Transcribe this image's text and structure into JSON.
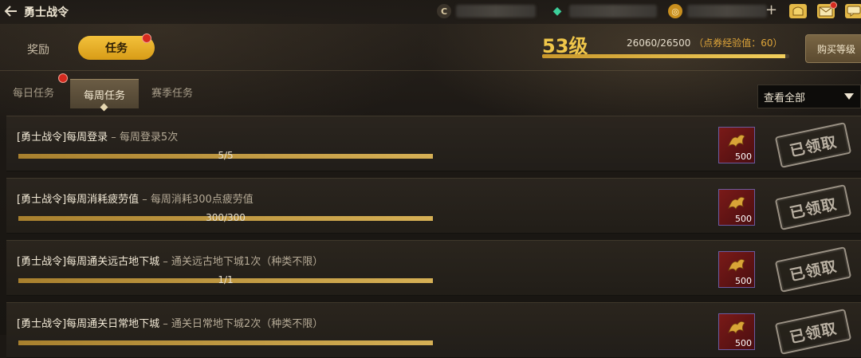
{
  "header": {
    "title": "勇士战令",
    "back_icon": "back-arrow-icon"
  },
  "currencies": [
    {
      "icon": "gold-c-icon",
      "symbol": "C",
      "color": "#d9c9a2"
    },
    {
      "icon": "green-gem-icon",
      "symbol": "◆",
      "color": "#3ccf9a"
    },
    {
      "icon": "gold-coin-icon",
      "symbol": "◎",
      "color": "#e0a92a"
    }
  ],
  "top_actions": {
    "plus": "+",
    "bag_icon": "treasure-bag-icon",
    "mail_icon": "mail-icon",
    "chat_icon": "chat-icon"
  },
  "main_tabs": {
    "reward": "奖励",
    "task": "任务"
  },
  "level": {
    "label": "53级",
    "exp_text": "26060/26500",
    "exp_note": "（点券经验值：60）",
    "progress": 0.983
  },
  "buy_button": "购买等级",
  "sub_tabs": {
    "daily": "每日任务",
    "weekly": "每周任务",
    "season": "赛季任务"
  },
  "filter": {
    "label": "查看全部"
  },
  "tasks": [
    {
      "title": "[勇士战令]每周登录",
      "desc": " – 每周登录5次",
      "progress_text": "5/5",
      "progress": 1.0,
      "reward": "500",
      "status": "已领取"
    },
    {
      "title": "[勇士战令]每周消耗疲劳值",
      "desc": " – 每周消耗300点疲劳值",
      "progress_text": "300/300",
      "progress": 1.0,
      "reward": "500",
      "status": "已领取"
    },
    {
      "title": "[勇士战令]每周通关远古地下城",
      "desc": " – 通关远古地下城1次（种类不限）",
      "progress_text": "1/1",
      "progress": 1.0,
      "reward": "500",
      "status": "已领取"
    },
    {
      "title": "[勇士战令]每周通关日常地下城",
      "desc": " – 通关日常地下城2次（种类不限）",
      "progress_text": "",
      "progress": 1.0,
      "reward": "500",
      "status": "已领取"
    }
  ]
}
